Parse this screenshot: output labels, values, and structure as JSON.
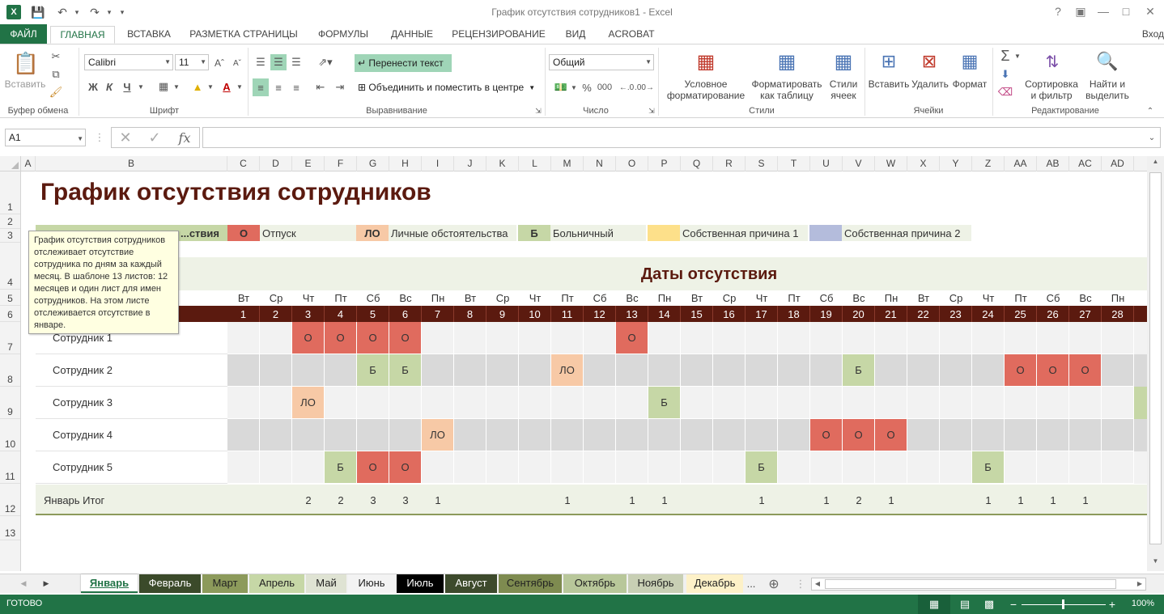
{
  "window": {
    "title": "График отсутствия сотрудников1 - Excel",
    "help": "?",
    "signin": "Вход"
  },
  "quick_access": {
    "logo": "X",
    "icons": [
      "save-icon",
      "undo-icon",
      "redo-icon",
      "customize-icon"
    ]
  },
  "ribbon_tabs": [
    {
      "label": "ФАЙЛ",
      "kind": "file"
    },
    {
      "label": "ГЛАВНАЯ",
      "kind": "active"
    },
    {
      "label": "ВСТАВКА"
    },
    {
      "label": "РАЗМЕТКА СТРАНИЦЫ"
    },
    {
      "label": "ФОРМУЛЫ"
    },
    {
      "label": "ДАННЫЕ"
    },
    {
      "label": "РЕЦЕНЗИРОВАНИЕ"
    },
    {
      "label": "ВИД"
    },
    {
      "label": "ACROBAT"
    }
  ],
  "ribbon": {
    "clipboard": {
      "paste": "Вставить",
      "label": "Буфер обмена"
    },
    "font": {
      "name": "Calibri",
      "size": "11",
      "bold": "Ж",
      "italic": "К",
      "underline": "Ч",
      "label": "Шрифт"
    },
    "alignment": {
      "wrap": "Перенести текст",
      "merge": "Объединить и поместить в центре",
      "label": "Выравнивание"
    },
    "number": {
      "format": "Общий",
      "percent": "%",
      "thousands": "000",
      "label": "Число"
    },
    "styles": {
      "conditional": "Условное\nформатирование",
      "as_table": "Форматировать\nкак таблицу",
      "cell_styles": "Стили\nячеек",
      "label": "Стили"
    },
    "cells": {
      "insert": "Вставить",
      "delete": "Удалить",
      "format": "Формат",
      "label": "Ячейки"
    },
    "editing": {
      "sort": "Сортировка\nи фильтр",
      "find": "Найти и\nвыделить",
      "label": "Редактирование"
    }
  },
  "formula_bar": {
    "name_box": "A1",
    "fx": "fx",
    "value": ""
  },
  "columns": [
    "A",
    "B",
    "C",
    "D",
    "E",
    "F",
    "G",
    "H",
    "I",
    "J",
    "K",
    "L",
    "M",
    "N",
    "O",
    "P",
    "Q",
    "R",
    "S",
    "T",
    "U",
    "V",
    "W",
    "X",
    "Y",
    "Z",
    "AA",
    "AB",
    "AC",
    "AD"
  ],
  "rows": [
    "1",
    "2",
    "3",
    "4",
    "5",
    "6",
    "7",
    "8",
    "9",
    "10",
    "11",
    "12",
    "13"
  ],
  "sheet": {
    "title": "График отсутствия сотрудников",
    "legend_key_label": "...ствия",
    "legend": [
      {
        "code": "О",
        "label": "Отпуск",
        "color": "#e06b5e"
      },
      {
        "code": "ЛО",
        "label": "Личные обстоятельства",
        "color": "#f7c9a6"
      },
      {
        "code": "Б",
        "label": "Больничный",
        "color": "#c6d7a6"
      },
      {
        "code": "",
        "label": "Собственная причина 1",
        "color": "#fde08a"
      },
      {
        "code": "",
        "label": "Собственная причина 2",
        "color": "#b4bcdc"
      }
    ],
    "dates_header": "Даты отсутствия",
    "weekdays": [
      "Вт",
      "Ср",
      "Чт",
      "Пт",
      "Сб",
      "Вс",
      "Пн",
      "Вт",
      "Ср",
      "Чт",
      "Пт",
      "Сб",
      "Вс",
      "Пн",
      "Вт",
      "Ср",
      "Чт",
      "Пт",
      "Сб",
      "Вс",
      "Пн",
      "Вт",
      "Ср",
      "Чт",
      "Пт",
      "Сб",
      "Вс",
      "Пн"
    ],
    "days": [
      "1",
      "2",
      "3",
      "4",
      "5",
      "6",
      "7",
      "8",
      "9",
      "10",
      "11",
      "12",
      "13",
      "14",
      "15",
      "16",
      "17",
      "18",
      "19",
      "20",
      "21",
      "22",
      "23",
      "24",
      "25",
      "26",
      "27",
      "28"
    ],
    "employees": [
      {
        "name": "Сотрудник 1",
        "marks": [
          "",
          "",
          "О",
          "О",
          "О",
          "О",
          "",
          "",
          "",
          "",
          "",
          "",
          "О",
          "",
          "",
          "",
          "",
          "",
          "",
          "",
          "",
          "",
          "",
          "",
          "",
          "",
          "",
          ""
        ]
      },
      {
        "name": "Сотрудник 2",
        "marks": [
          "",
          "",
          "",
          "",
          "Б",
          "Б",
          "",
          "",
          "",
          "",
          "ЛО",
          "",
          "",
          "",
          "",
          "",
          "",
          "",
          "",
          "Б",
          "",
          "",
          "",
          "",
          "О",
          "О",
          "О",
          ""
        ]
      },
      {
        "name": "Сотрудник 3",
        "marks": [
          "",
          "",
          "ЛО",
          "",
          "",
          "",
          "",
          "",
          "",
          "",
          "",
          "",
          "",
          "Б",
          "",
          "",
          "",
          "",
          "",
          "",
          "",
          "",
          "",
          "",
          "",
          "",
          "",
          ""
        ]
      },
      {
        "name": "Сотрудник 4",
        "marks": [
          "",
          "",
          "",
          "",
          "",
          "",
          "ЛО",
          "",
          "",
          "",
          "",
          "",
          "",
          "",
          "",
          "",
          "",
          "",
          "О",
          "О",
          "О",
          "",
          "",
          "",
          "",
          "",
          "",
          ""
        ]
      },
      {
        "name": "Сотрудник 5",
        "marks": [
          "",
          "",
          "",
          "Б",
          "О",
          "О",
          "",
          "",
          "",
          "",
          "",
          "",
          "",
          "",
          "",
          "",
          "Б",
          "",
          "",
          "",
          "",
          "",
          "",
          "Б",
          "",
          "",
          "",
          ""
        ]
      }
    ],
    "total_label": "Январь Итог",
    "totals": [
      "",
      "",
      "2",
      "2",
      "3",
      "3",
      "1",
      "",
      "",
      "",
      "1",
      "",
      "1",
      "1",
      "",
      "",
      "1",
      "",
      "1",
      "2",
      "1",
      "",
      "",
      "1",
      "1",
      "1",
      "1",
      ""
    ]
  },
  "tooltip": {
    "text": "График отсутствия сотрудников отслеживает отсутствие сотрудника по дням за каждый месяц. В шаблоне 13 листов: 12 месяцев и один лист для имен сотрудников. На этом листе отслеживается отсутствие в январе."
  },
  "sheet_tabs": [
    {
      "label": "Январь",
      "bg": "#ffffff",
      "fg": "#217346",
      "active": true
    },
    {
      "label": "Февраль",
      "bg": "#3b4a2a",
      "fg": "#ffffff"
    },
    {
      "label": "Март",
      "bg": "#8c9a5b",
      "fg": "#222222"
    },
    {
      "label": "Апрель",
      "bg": "#c6d7a6",
      "fg": "#222222"
    },
    {
      "label": "Май",
      "bg": "#dfe3d3",
      "fg": "#222222"
    },
    {
      "label": "Июнь",
      "bg": "#f3f3f3",
      "fg": "#222222"
    },
    {
      "label": "Июль",
      "bg": "#000000",
      "fg": "#ffffff"
    },
    {
      "label": "Август",
      "bg": "#3d4a2c",
      "fg": "#ffffff"
    },
    {
      "label": "Сентябрь",
      "bg": "#7e8b50",
      "fg": "#222222"
    },
    {
      "label": "Октябрь",
      "bg": "#b8c79a",
      "fg": "#222222"
    },
    {
      "label": "Ноябрь",
      "bg": "#c8cfb4",
      "fg": "#222222"
    },
    {
      "label": "Декабрь",
      "bg": "#fdf1c8",
      "fg": "#222222"
    }
  ],
  "more_sheets": "...",
  "status": {
    "ready": "ГОТОВО",
    "zoom": "100%"
  },
  "colors": {
    "excel_green": "#217346",
    "dark_red": "#5b1a0f",
    "header_band": "#eef2e6",
    "title": "#5b1a0f"
  }
}
